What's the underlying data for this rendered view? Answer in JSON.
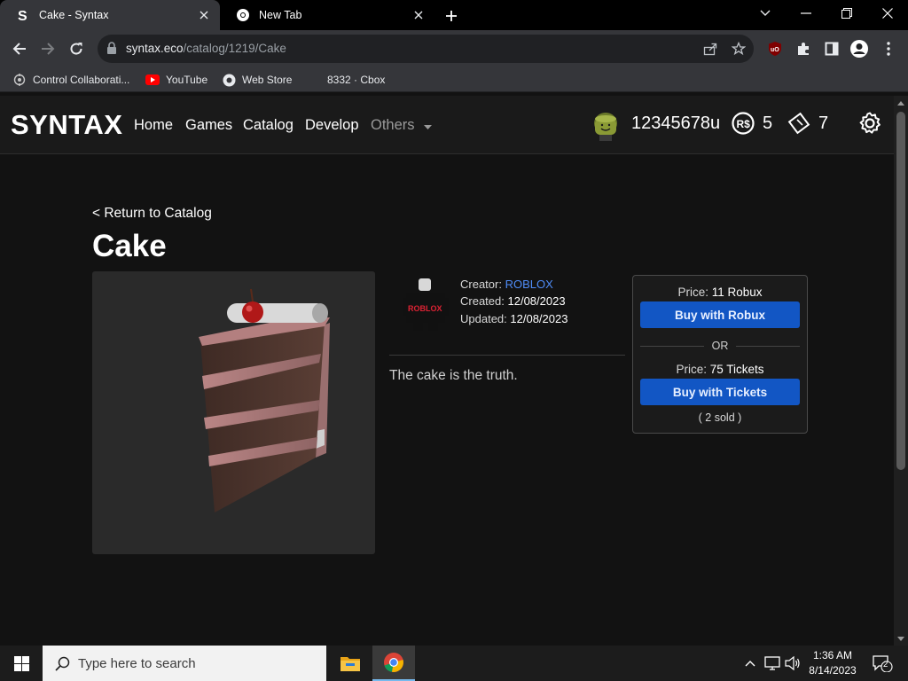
{
  "browser": {
    "tabs": [
      {
        "title": "Cake - Syntax",
        "favicon": "syntax-s-icon"
      },
      {
        "title": "New Tab",
        "favicon": "chrome-icon"
      }
    ],
    "url_host": "syntax.eco",
    "url_path": "/catalog/1219/Cake",
    "bookmarks": [
      {
        "label": "Control Collaborati...",
        "icon": "network-icon"
      },
      {
        "label": "YouTube",
        "icon": "youtube-icon"
      },
      {
        "label": "Web Store",
        "icon": "web-store-icon"
      },
      {
        "label": "8332 · Cbox",
        "icon": ""
      }
    ]
  },
  "site": {
    "brand": "SYNTAX",
    "nav": [
      "Home",
      "Games",
      "Catalog",
      "Develop",
      "Others"
    ],
    "username": "12345678u",
    "robux": "5",
    "tickets": "7"
  },
  "item": {
    "back_label": "< Return to Catalog",
    "title": "Cake",
    "creator_label": "Creator:",
    "creator": "ROBLOX",
    "created_label": "Created:",
    "created": "12/08/2023",
    "updated_label": "Updated:",
    "updated": "12/08/2023",
    "description": "The cake is the truth."
  },
  "buy": {
    "price_label": "Price:",
    "robux_price": "11 Robux",
    "robux_button": "Buy with Robux",
    "or": "OR",
    "tickets_price": "75 Tickets",
    "tickets_button": "Buy with Tickets",
    "sold": "( 2 sold )"
  },
  "taskbar": {
    "search_placeholder": "Type here to search",
    "time": "1:36 AM",
    "date": "8/14/2023",
    "notifications": "2"
  },
  "colors": {
    "accent_button": "#1256c4",
    "link": "#4f8cf7"
  }
}
